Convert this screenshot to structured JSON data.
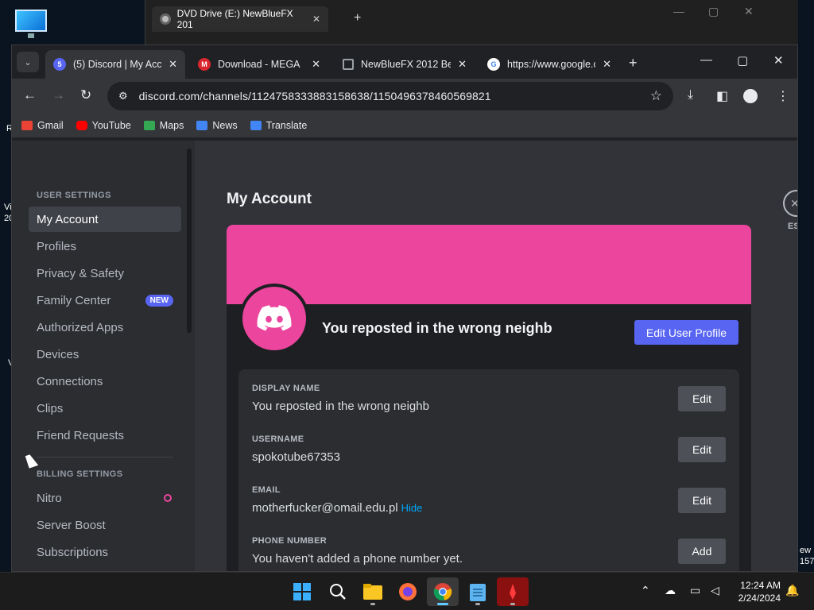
{
  "desktop": {
    "fragments": [
      "R",
      "Vi",
      "20",
      "V",
      "ew",
      "157"
    ]
  },
  "explorer": {
    "tab_title": "DVD Drive (E:) NewBlueFX 201",
    "close": "✕",
    "new_tab": "+",
    "controls": [
      "—",
      "▢",
      "✕"
    ]
  },
  "chrome": {
    "tab_list": "⌄",
    "tabs": [
      {
        "label": "(5) Discord | My Acco",
        "favicon_color": "#5865f2",
        "active": true
      },
      {
        "label": "Download - MEGA",
        "favicon_color": "#d9272e",
        "active": false
      },
      {
        "label": "NewBlueFX 2012 Bet",
        "favicon_color": "#9aa0a6",
        "active": false
      },
      {
        "label": "https://www.google.c",
        "favicon_color": "#4285f4",
        "active": false
      }
    ],
    "tab_close": "✕",
    "new_tab": "+",
    "window_controls": [
      "—",
      "▢",
      "✕"
    ],
    "url": "discord.com/channels/1124758333883158638/1150496378460569821",
    "bookmarks": [
      {
        "label": "Gmail",
        "color": "#ea4335"
      },
      {
        "label": "YouTube",
        "color": "#ff0000"
      },
      {
        "label": "Maps",
        "color": "#34a853"
      },
      {
        "label": "News",
        "color": "#4285f4"
      },
      {
        "label": "Translate",
        "color": "#4285f4"
      }
    ]
  },
  "discord": {
    "user_settings_header": "USER SETTINGS",
    "sidebar_items": [
      {
        "label": "My Account",
        "active": true
      },
      {
        "label": "Profiles"
      },
      {
        "label": "Privacy & Safety"
      },
      {
        "label": "Family Center",
        "badge": "NEW"
      },
      {
        "label": "Authorized Apps"
      },
      {
        "label": "Devices"
      },
      {
        "label": "Connections"
      },
      {
        "label": "Clips"
      },
      {
        "label": "Friend Requests"
      }
    ],
    "billing_header": "BILLING SETTINGS",
    "billing_items": [
      {
        "label": "Nitro"
      },
      {
        "label": "Server Boost"
      },
      {
        "label": "Subscriptions"
      }
    ],
    "page_title": "My Account",
    "profile_name": "You reposted in the wrong neighb",
    "edit_profile_label": "Edit User Profile",
    "fields": [
      {
        "label": "DISPLAY NAME",
        "value": "You reposted in the wrong neighb",
        "button": "Edit"
      },
      {
        "label": "USERNAME",
        "value": "spokotube67353",
        "button": "Edit"
      },
      {
        "label": "EMAIL",
        "value": "motherfucker@omail.edu.pl",
        "extra": "Hide",
        "button": "Edit"
      },
      {
        "label": "PHONE NUMBER",
        "value": "You haven't added a phone number yet.",
        "button": "Add"
      }
    ],
    "esc_label": "ES",
    "banner_color": "#eb459e",
    "accent_color": "#5865f2"
  },
  "taskbar": {
    "time": "12:24 AM",
    "date": "2/24/2024"
  }
}
